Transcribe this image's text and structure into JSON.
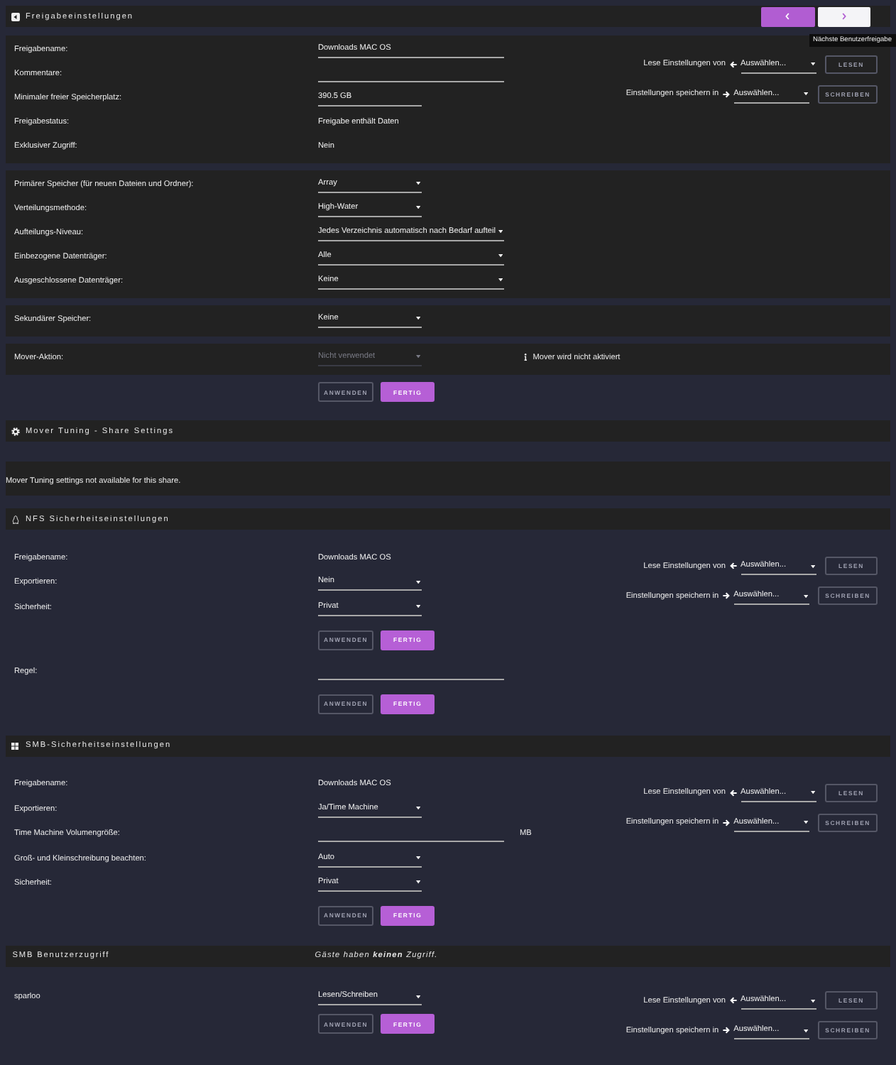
{
  "sections": [
    {
      "kind": "share",
      "title": "Freigabeeinstellungen",
      "nav": [
        {
          "kind": "previous",
          "hovered": false
        },
        {
          "kind": "next",
          "hovered": true,
          "tooltip": "Nächste Benutzerfreigabe"
        }
      ],
      "clone": [
        {
          "kind": "read",
          "label": "Lese Einstellungen von",
          "select": "Auswählen...",
          "button": {
            "label": "LESEN",
            "disabled": true
          }
        },
        {
          "kind": "write",
          "label": "Einstellungen speichern in",
          "select": "Auswählen...",
          "button": {
            "label": "SCHREIBEN",
            "disabled": true
          }
        }
      ],
      "blocks": [
        {
          "rows": [
            {
              "label": "Freigabename:",
              "kind": "input",
              "value": "Downloads MAC OS"
            },
            {
              "label": "Kommentare:",
              "kind": "input"
            },
            {
              "label": "Minimaler freier Speicherplatz:",
              "kind": "input_short",
              "value": "390.5 GB"
            },
            {
              "label": "Freigabestatus:",
              "kind": "text",
              "value": "Freigabe enthält Daten"
            },
            {
              "label": "Exklusiver Zugriff:",
              "kind": "text",
              "value": "Nein"
            }
          ]
        },
        {
          "rows": [
            {
              "label": "Primärer Speicher (für neuen Dateien und Ordner):",
              "kind": "select",
              "value": "Array"
            },
            {
              "label": "Verteilungsmethode:",
              "kind": "select",
              "value": "High-Water"
            },
            {
              "label": "Aufteilungs-Niveau:",
              "kind": "select_wide",
              "value": "Jedes Verzeichnis automatisch nach Bedarf aufteil"
            },
            {
              "label": "Einbezogene Datenträger:",
              "kind": "select_wide",
              "value": "Alle"
            },
            {
              "label": "Ausgeschlossene Datenträger:",
              "kind": "select_wide",
              "value": "Keine"
            }
          ]
        },
        {
          "rows": [
            {
              "label": "Sekundärer Speicher:",
              "kind": "select",
              "value": "Keine"
            }
          ]
        },
        {
          "rows": [
            {
              "label": "Mover-Aktion:",
              "kind": "select",
              "value": "Nicht verwendet",
              "disabled": true,
              "note": "Mover wird nicht aktiviert"
            }
          ]
        }
      ],
      "buttons": [
        {
          "label": "ANWENDEN",
          "disabled": true
        },
        {
          "label": "FERTIG",
          "disabled": false
        }
      ]
    },
    {
      "kind": "mover",
      "title": "Mover Tuning - Share Settings",
      "message": "Mover Tuning settings not available for this share."
    },
    {
      "kind": "nfs",
      "title": "NFS Sicherheitseinstellungen",
      "clone": [
        {
          "kind": "read",
          "label": "Lese Einstellungen von",
          "select": "Auswählen...",
          "button": {
            "label": "LESEN",
            "disabled": true
          }
        },
        {
          "kind": "write",
          "label": "Einstellungen speichern in",
          "select": "Auswählen...",
          "button": {
            "label": "SCHREIBEN",
            "disabled": true
          }
        }
      ],
      "blocks": [
        {
          "rows": [
            {
              "label": "Freigabename:",
              "kind": "text",
              "value": "Downloads MAC OS"
            },
            {
              "label": "Exportieren:",
              "kind": "select",
              "value": "Nein"
            },
            {
              "label": "Sicherheit:",
              "kind": "select",
              "value": "Privat"
            }
          ],
          "buttons": [
            {
              "label": "ANWENDEN",
              "disabled": true
            },
            {
              "label": "FERTIG",
              "disabled": false
            }
          ]
        },
        {
          "rows": [
            {
              "label": "Regel:",
              "kind": "input"
            }
          ],
          "buttons": [
            {
              "label": "ANWENDEN",
              "disabled": true
            },
            {
              "label": "FERTIG",
              "disabled": false
            }
          ]
        }
      ]
    },
    {
      "kind": "smb",
      "title": "SMB-Sicherheitseinstellungen",
      "clone": [
        {
          "kind": "read",
          "label": "Lese Einstellungen von",
          "select": "Auswählen...",
          "button": {
            "label": "LESEN",
            "disabled": true
          }
        },
        {
          "kind": "write",
          "label": "Einstellungen speichern in",
          "select": "Auswählen...",
          "button": {
            "label": "SCHREIBEN",
            "disabled": true
          }
        }
      ],
      "blocks": [
        {
          "rows": [
            {
              "label": "Freigabename:",
              "kind": "text",
              "value": "Downloads MAC OS"
            },
            {
              "label": "Exportieren:",
              "kind": "select",
              "value": "Ja/Time Machine"
            },
            {
              "label": "Time Machine Volumengröße:",
              "kind": "input",
              "unit": "MB"
            },
            {
              "label": "Groß- und Kleinschreibung beachten:",
              "kind": "select",
              "value": "Auto"
            },
            {
              "label": "Sicherheit:",
              "kind": "select",
              "value": "Privat"
            }
          ],
          "buttons": [
            {
              "label": "ANWENDEN",
              "disabled": true
            },
            {
              "label": "FERTIG",
              "disabled": false
            }
          ]
        }
      ]
    },
    {
      "kind": "users",
      "title": "SMB Benutzerzugriff",
      "note": "Gäste haben **keinen** Zugriff.",
      "clone": [
        {
          "kind": "read",
          "label": "Lese Einstellungen von",
          "select": "Auswählen...",
          "button": {
            "label": "LESEN",
            "disabled": true
          }
        },
        {
          "kind": "write",
          "label": "Einstellungen speichern in",
          "select": "Auswählen...",
          "button": {
            "label": "SCHREIBEN",
            "disabled": true
          }
        }
      ],
      "blocks": [
        {
          "rows": [
            {
              "label": "sparloo",
              "kind": "select",
              "value": "Lesen/Schreiben"
            }
          ],
          "buttons": [
            {
              "label": "ANWENDEN",
              "disabled": true
            },
            {
              "label": "FERTIG",
              "disabled": false
            }
          ]
        }
      ]
    }
  ]
}
